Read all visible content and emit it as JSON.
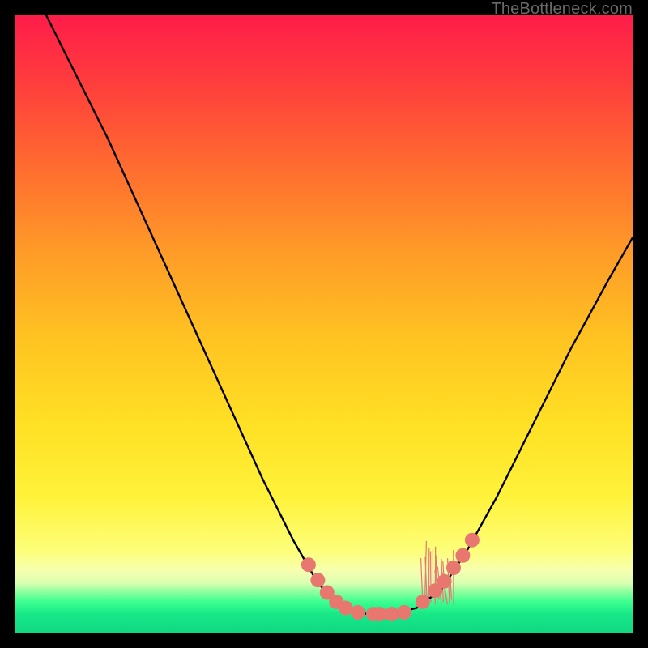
{
  "watermark": "TheBottleneck.com",
  "chart_data": {
    "type": "line",
    "title": "",
    "xlabel": "",
    "ylabel": "",
    "xlim": [
      0,
      100
    ],
    "ylim": [
      0,
      100
    ],
    "grid": false,
    "legend": false,
    "series": [
      {
        "name": "bottleneck-curve",
        "color": "#000000",
        "points": [
          {
            "x": 5,
            "y": 100
          },
          {
            "x": 10,
            "y": 90
          },
          {
            "x": 15,
            "y": 80
          },
          {
            "x": 20,
            "y": 69
          },
          {
            "x": 25,
            "y": 58
          },
          {
            "x": 30,
            "y": 47
          },
          {
            "x": 35,
            "y": 36
          },
          {
            "x": 40,
            "y": 25
          },
          {
            "x": 45,
            "y": 15
          },
          {
            "x": 49,
            "y": 8
          },
          {
            "x": 53,
            "y": 4
          },
          {
            "x": 57,
            "y": 3
          },
          {
            "x": 61,
            "y": 3
          },
          {
            "x": 65,
            "y": 4
          },
          {
            "x": 69,
            "y": 7
          },
          {
            "x": 73,
            "y": 13
          },
          {
            "x": 78,
            "y": 22
          },
          {
            "x": 84,
            "y": 34
          },
          {
            "x": 90,
            "y": 46
          },
          {
            "x": 96,
            "y": 57
          },
          {
            "x": 100,
            "y": 64
          }
        ]
      }
    ],
    "markers": {
      "color": "#e7776f",
      "radius_px": 9,
      "points": [
        {
          "x": 47.5,
          "y": 11
        },
        {
          "x": 49.0,
          "y": 8.5
        },
        {
          "x": 50.5,
          "y": 6.5
        },
        {
          "x": 52.0,
          "y": 5
        },
        {
          "x": 53.5,
          "y": 4
        },
        {
          "x": 55.5,
          "y": 3.3
        },
        {
          "x": 58.0,
          "y": 3
        },
        {
          "x": 59.0,
          "y": 3
        },
        {
          "x": 61.0,
          "y": 3
        },
        {
          "x": 63.0,
          "y": 3.3
        },
        {
          "x": 66.0,
          "y": 5
        },
        {
          "x": 68.0,
          "y": 6.8
        },
        {
          "x": 69.5,
          "y": 8.3
        },
        {
          "x": 71.0,
          "y": 10.5
        },
        {
          "x": 72.5,
          "y": 12.5
        },
        {
          "x": 74.0,
          "y": 15
        }
      ]
    },
    "hair_tufts": {
      "color": "#e7776f",
      "x_range": [
        66,
        71
      ],
      "y_top": 13,
      "y_base": 5
    }
  }
}
